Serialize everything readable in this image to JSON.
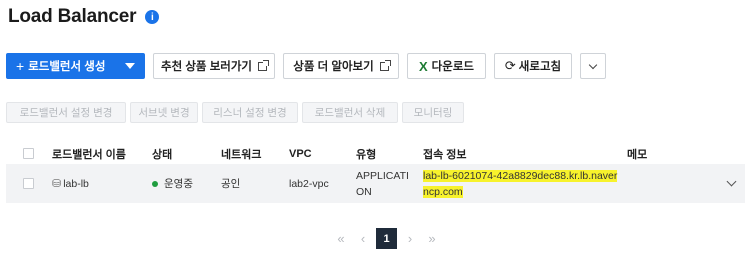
{
  "header": {
    "title": "Load Balancer",
    "help_badge": "i"
  },
  "toolbar": {
    "create_label": "로드밸런서 생성",
    "recommend_label": "추천 상품 보러가기",
    "learn_more_label": "상품 더 알아보기",
    "download_label": "다운로드",
    "refresh_label": "새로고침"
  },
  "actions": {
    "settings_change": "로드밸런서 설정 변경",
    "subnet_change": "서브넷 변경",
    "listener_change": "리스너 설정 변경",
    "delete": "로드밸런서 삭제",
    "monitoring": "모니터링"
  },
  "table": {
    "columns": {
      "name": "로드밸런서 이름",
      "status": "상태",
      "network": "네트워크",
      "vpc": "VPC",
      "type": "유형",
      "endpoint": "접속 정보",
      "memo": "메모"
    },
    "rows": [
      {
        "name": "lab-lb",
        "status": "운영중",
        "network": "공인",
        "vpc": "lab2-vpc",
        "type": "APPLICATION",
        "endpoint": "lab-lb-6021074-42a8829dec88.kr.lb.naverncp.com",
        "memo": ""
      }
    ]
  },
  "pagination": {
    "current": "1"
  },
  "colors": {
    "primary": "#1a73e8",
    "status_ok": "#1f9d3f",
    "highlight": "#f7f22c"
  },
  "icons": [
    "help-badge-icon",
    "plus-icon",
    "caret-down-icon",
    "external-link-icon",
    "excel-icon",
    "refresh-icon",
    "chevron-down-icon",
    "database-icon"
  ]
}
